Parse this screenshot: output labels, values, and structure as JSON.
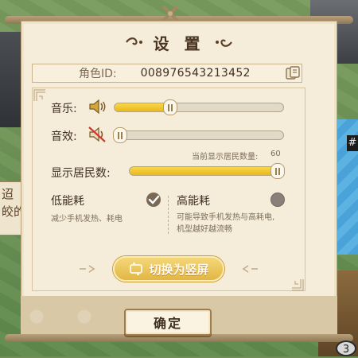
{
  "dialog": {
    "title": "设 置",
    "player_id_label": "角色ID:",
    "player_id_value": "008976543213452"
  },
  "audio": {
    "music_label": "音乐:",
    "music_level_pct": 33,
    "sfx_label": "音效:",
    "sfx_level_pct": 0,
    "sfx_muted": true
  },
  "residents": {
    "current_label": "当前显示居民数量:",
    "current_value": "60",
    "label": "显示居民数:",
    "level_pct": 100
  },
  "power_modes": {
    "low": {
      "title": "低能耗",
      "desc": "减少手机发热、耗电",
      "selected": true
    },
    "high": {
      "title": "高能耗",
      "desc_line1": "可能导致手机发热与高耗电,",
      "desc_line2": "机型越好越流畅",
      "selected": false
    }
  },
  "buttons": {
    "switch_orientation": "切换为竖屏",
    "confirm": "确定"
  },
  "background": {
    "side_banner_text": "迢\n皎的",
    "corner_badge": "3",
    "corner_hash": "#"
  },
  "colors": {
    "accent_yellow": "#f2c931",
    "panel_bg": "#f5ecd9",
    "text_dark": "#3e2f21"
  }
}
